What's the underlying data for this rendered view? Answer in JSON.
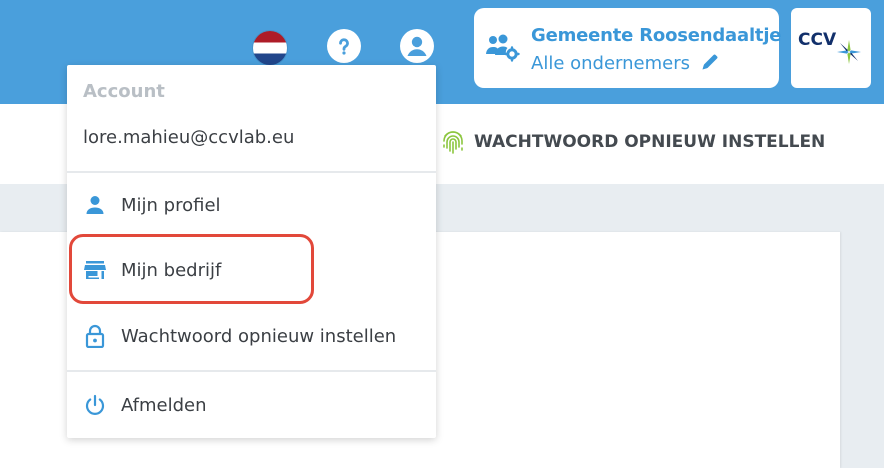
{
  "header": {
    "organization": {
      "name": "Gemeente Roosendaaltje",
      "subtitle": "Alle ondernemers"
    },
    "logo": {
      "text": "CCV"
    },
    "icons": [
      "netherlands-flag-icon",
      "help-icon",
      "user-account-icon",
      "users-cog-icon",
      "pencil-icon"
    ]
  },
  "subnav": {
    "item_label": "WACHTWOORD OPNIEUW INSTELLEN",
    "icon": "fingerprint-icon"
  },
  "account_menu": {
    "header": "Account",
    "email": "lore.mahieu@ccvlab.eu",
    "items": [
      {
        "label": "Mijn profiel",
        "icon": "person-icon"
      },
      {
        "label": "Mijn bedrijf",
        "icon": "store-icon"
      },
      {
        "label": "Wachtwoord opnieuw instellen",
        "icon": "lock-icon"
      },
      {
        "label": "Afmelden",
        "icon": "power-icon"
      }
    ]
  },
  "colors": {
    "primary": "#4a9fdc",
    "accent_text": "#3a97d8",
    "highlight": "#e2483a",
    "fingerprint": "#8cc63f"
  }
}
